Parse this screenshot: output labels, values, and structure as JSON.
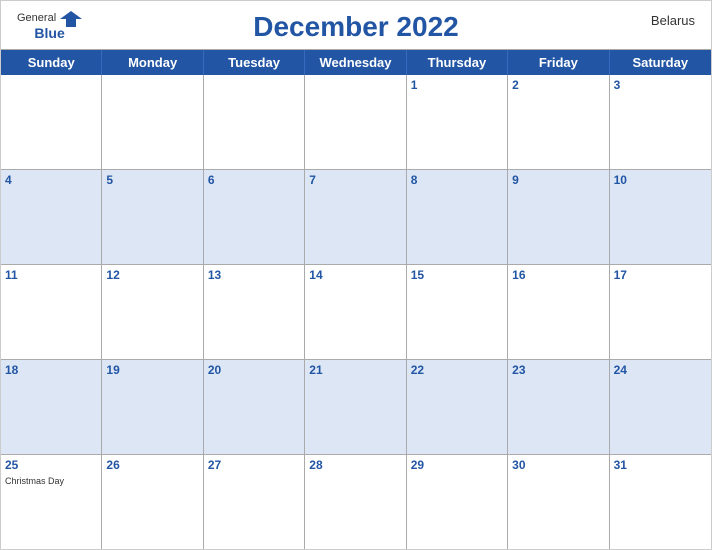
{
  "header": {
    "logo": {
      "general": "General",
      "blue": "Blue",
      "bird_unicode": "🔵"
    },
    "title": "December 2022",
    "country": "Belarus"
  },
  "day_headers": [
    "Sunday",
    "Monday",
    "Tuesday",
    "Wednesday",
    "Thursday",
    "Friday",
    "Saturday"
  ],
  "weeks": [
    [
      {
        "day": "",
        "empty": true
      },
      {
        "day": "",
        "empty": true
      },
      {
        "day": "",
        "empty": true
      },
      {
        "day": "",
        "empty": true
      },
      {
        "day": "1",
        "empty": false
      },
      {
        "day": "2",
        "empty": false
      },
      {
        "day": "3",
        "empty": false
      }
    ],
    [
      {
        "day": "4",
        "empty": false
      },
      {
        "day": "5",
        "empty": false
      },
      {
        "day": "6",
        "empty": false
      },
      {
        "day": "7",
        "empty": false
      },
      {
        "day": "8",
        "empty": false
      },
      {
        "day": "9",
        "empty": false
      },
      {
        "day": "10",
        "empty": false
      }
    ],
    [
      {
        "day": "11",
        "empty": false
      },
      {
        "day": "12",
        "empty": false
      },
      {
        "day": "13",
        "empty": false
      },
      {
        "day": "14",
        "empty": false
      },
      {
        "day": "15",
        "empty": false
      },
      {
        "day": "16",
        "empty": false
      },
      {
        "day": "17",
        "empty": false
      }
    ],
    [
      {
        "day": "18",
        "empty": false
      },
      {
        "day": "19",
        "empty": false
      },
      {
        "day": "20",
        "empty": false
      },
      {
        "day": "21",
        "empty": false
      },
      {
        "day": "22",
        "empty": false
      },
      {
        "day": "23",
        "empty": false
      },
      {
        "day": "24",
        "empty": false
      }
    ],
    [
      {
        "day": "25",
        "empty": false,
        "holiday": "Christmas Day"
      },
      {
        "day": "26",
        "empty": false
      },
      {
        "day": "27",
        "empty": false
      },
      {
        "day": "28",
        "empty": false
      },
      {
        "day": "29",
        "empty": false
      },
      {
        "day": "30",
        "empty": false
      },
      {
        "day": "31",
        "empty": false
      }
    ]
  ],
  "row_colors": [
    "white",
    "blue",
    "white",
    "blue",
    "white"
  ],
  "colors": {
    "primary_blue": "#2255a4",
    "light_blue_row": "#dce6f5",
    "header_bg": "#2255a4",
    "text_white": "#ffffff",
    "border": "#aaaaaa"
  }
}
